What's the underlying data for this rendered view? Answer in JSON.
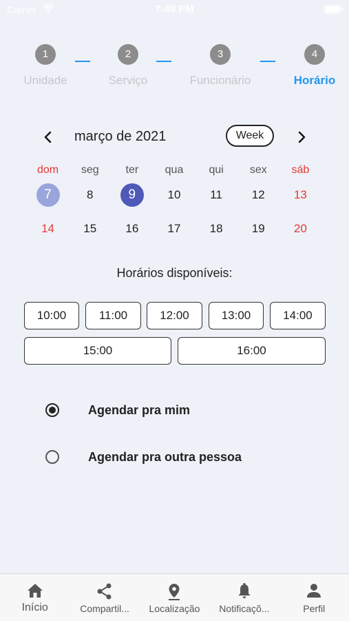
{
  "status_bar": {
    "carrier": "Carrier",
    "time": "7:49 PM"
  },
  "stepper": {
    "steps": [
      {
        "number": "1",
        "label": "Unidade"
      },
      {
        "number": "2",
        "label": "Serviço"
      },
      {
        "number": "3",
        "label": "Funcionário"
      },
      {
        "number": "4",
        "label": "Horário"
      }
    ],
    "active_color": "#2196f3"
  },
  "calendar": {
    "month_title": "março de 2021",
    "view_toggle": "Week",
    "weekdays": [
      "dom",
      "seg",
      "ter",
      "qua",
      "qui",
      "sex",
      "sáb"
    ],
    "week1": [
      "7",
      "8",
      "9",
      "10",
      "11",
      "12",
      "13"
    ],
    "week2": [
      "14",
      "15",
      "16",
      "17",
      "18",
      "19",
      "20"
    ],
    "today": "7",
    "selected": "9",
    "weekend_color": "#e53935"
  },
  "slots": {
    "title": "Horários disponíveis:",
    "times": [
      "10:00",
      "11:00",
      "12:00",
      "13:00",
      "14:00",
      "15:00",
      "16:00"
    ]
  },
  "booking_options": {
    "self": "Agendar pra mim",
    "other": "Agendar pra outra pessoa",
    "selected": "self"
  },
  "tab_bar": {
    "tabs": [
      "Início",
      "Compartil...",
      "Localização",
      "Notificaçõ...",
      "Perfil"
    ]
  }
}
